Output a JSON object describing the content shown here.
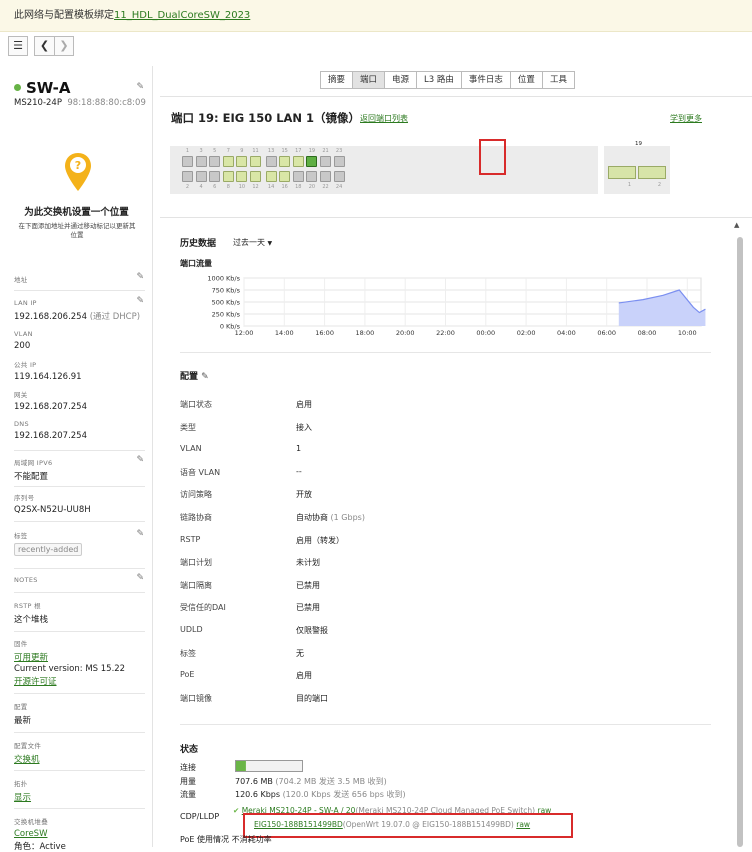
{
  "banner": {
    "prefix": "此网络与配置模板绑定",
    "link": "11_HDL_DualCoreSW_2023"
  },
  "toolbar": {
    "list_icon": "list-icon",
    "back_icon": "chevron-left-icon",
    "fwd_icon": "chevron-right-icon"
  },
  "sidebar": {
    "name": "SW-A",
    "model": "MS210-24P",
    "mac": "98:18:88:80:c8:09",
    "location_title": "为此交换机设置一个位置",
    "location_sub": "在下面添加地址并通过移动标记以更新其位置",
    "address_label": "地址",
    "lanip_label": "LAN IP",
    "lanip_value": "192.168.206.254",
    "lanip_note": "(通过 DHCP)",
    "vlan_label": "VLAN",
    "vlan_value": "200",
    "public_ip_label": "公共 IP",
    "public_ip_value": "119.164.126.91",
    "gateway_label": "网关",
    "gateway_value": "192.168.207.254",
    "dns_label": "DNS",
    "dns_value": "192.168.207.254",
    "ipv6_label": "局域网 IPV6",
    "ipv6_value": "不能配置",
    "serial_label": "序列号",
    "serial_value": "Q2SX-N52U-UU8H",
    "tags_label": "标签",
    "tag_value": "recently-added",
    "notes_label": "NOTES",
    "rstp_label": "RSTP 根",
    "rstp_value": "这个堆栈",
    "firmware_label": "固件",
    "firmware_link": "可用更新",
    "firmware_version": "Current version: MS 15.22",
    "firmware_license": "开源许可证",
    "config_label": "配置",
    "config_value": "最新",
    "config_file_label": "配置文件",
    "config_file_link": "交换机",
    "topology_label": "拓扑",
    "topology_link": "显示",
    "stack_label": "交换机堆叠",
    "stack_link": "CoreSW",
    "role_value": "角色：Active"
  },
  "tabs": [
    {
      "label": "摘要",
      "active": false
    },
    {
      "label": "端口",
      "active": true
    },
    {
      "label": "电源",
      "active": false
    },
    {
      "label": "L3 路由",
      "active": false
    },
    {
      "label": "事件日志",
      "active": false
    },
    {
      "label": "位置",
      "active": false
    },
    {
      "label": "工具",
      "active": false
    }
  ],
  "port_header": {
    "title": "端口 19: EIG 150 LAN 1（镜像）",
    "back_link": "返回端口列表",
    "learn_link": "学到更多"
  },
  "port_panel": {
    "top_numbers": [
      "1",
      "3",
      "5",
      "7",
      "9",
      "11",
      "13",
      "15",
      "17",
      "19",
      "21",
      "23"
    ],
    "bottom_numbers": [
      "2",
      "4",
      "6",
      "8",
      "10",
      "12",
      "14",
      "16",
      "18",
      "20",
      "22",
      "24"
    ],
    "selected_label": "19",
    "sfp_numbers": [
      "1",
      "2"
    ]
  },
  "history": {
    "title": "历史数据",
    "range": "过去一天"
  },
  "chart_data": {
    "type": "area",
    "title": "端口流量",
    "x": [
      "12:00",
      "14:00",
      "16:00",
      "18:00",
      "20:00",
      "22:00",
      "00:00",
      "02:00",
      "04:00",
      "06:00",
      "08:00",
      "10:00"
    ],
    "yticks": [
      "1000 Kb/s",
      "750 Kb/s",
      "500 Kb/s",
      "250 Kb/s",
      "0 Kb/s"
    ],
    "ylim": [
      0,
      1000
    ],
    "series": [
      {
        "points": [
          [
            9.3,
            480
          ],
          [
            9.9,
            550
          ],
          [
            10.4,
            640
          ],
          [
            10.8,
            750
          ],
          [
            11.15,
            390
          ],
          [
            11.3,
            280
          ],
          [
            11.45,
            350
          ]
        ]
      }
    ],
    "grid": true,
    "color": "#7b8ff0"
  },
  "config": {
    "title": "配置",
    "rows": [
      {
        "k": "端口状态",
        "v": "启用",
        "note": ""
      },
      {
        "k": "类型",
        "v": "接入",
        "note": ""
      },
      {
        "k": "VLAN",
        "v": "1",
        "note": ""
      },
      {
        "k": "语音 VLAN",
        "v": "--",
        "note": ""
      },
      {
        "k": "访问策略",
        "v": "开放",
        "note": ""
      },
      {
        "k": "链路协商",
        "v": "自动协商",
        "note": "(1 Gbps)"
      },
      {
        "k": "RSTP",
        "v": "启用（转发）",
        "note": ""
      },
      {
        "k": "端口计划",
        "v": "未计划",
        "note": ""
      },
      {
        "k": "端口隔离",
        "v": "已禁用",
        "note": ""
      },
      {
        "k": "受信任的DAI",
        "v": "已禁用",
        "note": ""
      },
      {
        "k": "UDLD",
        "v": "仅限警报",
        "note": ""
      },
      {
        "k": "标签",
        "v": "无",
        "note": ""
      },
      {
        "k": "PoE",
        "v": "启用",
        "note": ""
      },
      {
        "k": "端口镜像",
        "v": "目的端口",
        "note": ""
      }
    ]
  },
  "status": {
    "title": "状态",
    "link_label": "连接",
    "usage_label": "用量",
    "usage_value": "707.6 MB",
    "usage_note": "(704.2 MB 发送 3.5 MB 收到)",
    "flow_label": "流量",
    "flow_value": "120.6 Kbps",
    "flow_note": "(120.0 Kbps 发送 656 bps 收到)",
    "cdp_label": "CDP/LLDP",
    "cdp1_link": "Meraki MS210-24P - SW-A / 20",
    "cdp1_note": "(Meraki MS210-24P Cloud Managed PoE Switch)",
    "cdp1_raw": "raw",
    "cdp2_link": "EIG150-188B151499BD",
    "cdp2_note": "(OpenWrt 19.07.0 @ EIG150-188B151499BD)",
    "cdp2_raw": "raw",
    "poe_label": "PoE 使用情况",
    "poe_value": "不消耗功率",
    "link_fill": 0.15
  }
}
